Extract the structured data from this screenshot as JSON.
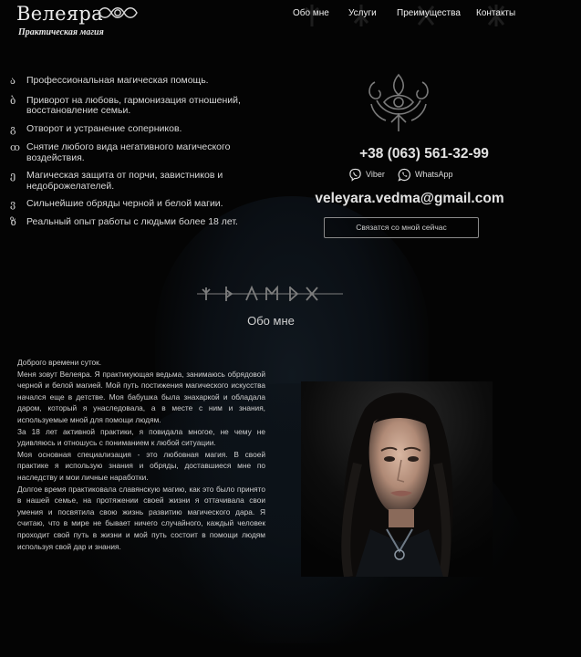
{
  "header": {
    "brand_title": "Велеяра",
    "brand_subtitle": "Практическая магия",
    "nav": [
      {
        "label": "Обо мне"
      },
      {
        "label": "Услуги"
      },
      {
        "label": "Преимущества"
      },
      {
        "label": "Контакты"
      }
    ]
  },
  "services": [
    {
      "glyph": "ა",
      "text": "Профессиональная магическая помощь."
    },
    {
      "glyph": "ბ",
      "text": "Приворот на любовь, гармонизация отношений, восстановление семьи."
    },
    {
      "glyph": "გ",
      "text": "Отворот и устранение соперников."
    },
    {
      "glyph": "ꝏ",
      "text": "Снятие любого вида негативного магического воздействия."
    },
    {
      "glyph": "ე",
      "text": "Магическая защита от порчи, завистников и недоброжелателей."
    },
    {
      "glyph": "ვ",
      "text": "Сильнейшие обряды черной и белой магии."
    },
    {
      "glyph": "ზ",
      "text": "Реальный опыт работы с людьми более 18 лет."
    }
  ],
  "contacts": {
    "phone": "+38 (063) 561-32-99",
    "viber_label": "Viber",
    "whatsapp_label": "WhatsApp",
    "email": "veleyara.vedma@gmail.com",
    "cta_label": "Связатся со мной сейчас"
  },
  "about": {
    "title": "Обо мне",
    "paragraphs": [
      "Доброго времени суток.",
      "Меня зовут Велеяра. Я практикующая ведьма, занимаюсь обрядовой черной и белой магией. Мой путь постижения магического искусства начался еще в детстве. Моя бабушка была знахаркой и обладала даром, который я унаследовала, а в месте с ним и знания, используемые мной для помощи людям.",
      "За 18 лет активной практики, я повидала многое, не чему не удивляюсь и отношусь с пониманием к любой ситуации.",
      "Моя основная специализация - это любовная магия. В своей практике я использую знания и обряды, доставшиеся мне по наследству и мои личные наработки.",
      "Долгое время практиковала славянскую магию, как это было принято в нашей семье, на протяжении своей жизни я оттачивала свои умения и посвятила свою жизнь развитию магического дара. Я считаю, что в мире не бывает ничего случайного, каждый человек проходит свой путь в жизни и мой путь состоит в помощи людям используя свой дар и знания."
    ]
  },
  "colors": {
    "background": "#040404",
    "text": "#d6d6d6",
    "accent_line": "#8a8a8a",
    "viber": "#ffffff",
    "whatsapp": "#ffffff"
  },
  "icons": {
    "brand": "celtic-knot-icon",
    "emblem": "eye-emblem-icon",
    "divider": "runes-divider-icon",
    "viber": "viber-icon",
    "whatsapp": "whatsapp-icon"
  }
}
